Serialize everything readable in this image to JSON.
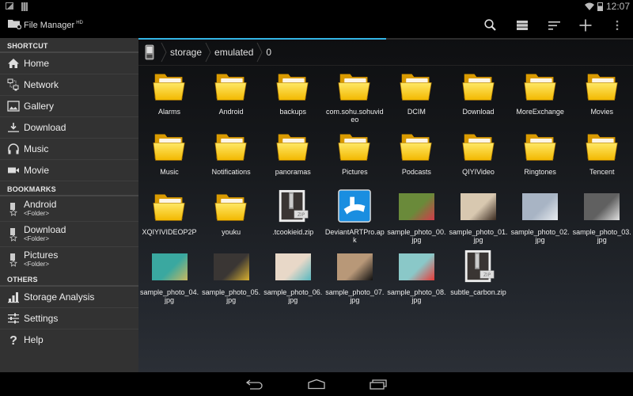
{
  "status_bar": {
    "time": "12:07",
    "icons": [
      "image-notification-icon",
      "sd-card-icon",
      "wifi-icon",
      "battery-icon"
    ]
  },
  "action_bar": {
    "app_title": "File Manager",
    "app_badge": "HD",
    "actions": [
      {
        "name": "search",
        "icon": "search-icon"
      },
      {
        "name": "view-mode",
        "icon": "list-view-icon"
      },
      {
        "name": "sort",
        "icon": "sort-icon"
      },
      {
        "name": "new",
        "icon": "plus-icon"
      },
      {
        "name": "overflow",
        "icon": "more-vert-icon"
      }
    ]
  },
  "sidebar": {
    "shortcut_header": "SHORTCUT",
    "shortcuts": [
      {
        "label": "Home",
        "icon": "home-icon"
      },
      {
        "label": "Network",
        "icon": "network-icon"
      },
      {
        "label": "Gallery",
        "icon": "gallery-icon"
      },
      {
        "label": "Download",
        "icon": "download-icon"
      },
      {
        "label": "Music",
        "icon": "headphones-icon"
      },
      {
        "label": "Movie",
        "icon": "video-camera-icon"
      }
    ],
    "bookmarks_header": "BOOKMARKS",
    "bookmarks": [
      {
        "label": "Android",
        "sub": "<Folder>"
      },
      {
        "label": "Download",
        "sub": "<Folder>"
      },
      {
        "label": "Pictures",
        "sub": "<Folder>"
      }
    ],
    "others_header": "OTHERS",
    "others": [
      {
        "label": "Storage Analysis",
        "icon": "bar-chart-icon"
      },
      {
        "label": "Settings",
        "icon": "sliders-icon"
      },
      {
        "label": "Help",
        "icon": "question-icon"
      }
    ]
  },
  "main": {
    "load_progress": 0.5,
    "accent_color": "#33b5e5",
    "breadcrumb": [
      "storage",
      "emulated",
      "0"
    ],
    "files": [
      {
        "name": "Alarms",
        "type": "folder"
      },
      {
        "name": "Android",
        "type": "folder"
      },
      {
        "name": "backups",
        "type": "folder"
      },
      {
        "name": "com.sohu.sohuvideo",
        "type": "folder"
      },
      {
        "name": "DCIM",
        "type": "folder"
      },
      {
        "name": "Download",
        "type": "folder"
      },
      {
        "name": "MoreExchange",
        "type": "folder"
      },
      {
        "name": "Movies",
        "type": "folder"
      },
      {
        "name": "Music",
        "type": "folder"
      },
      {
        "name": "Notifications",
        "type": "folder"
      },
      {
        "name": "panoramas",
        "type": "folder"
      },
      {
        "name": "Pictures",
        "type": "folder"
      },
      {
        "name": "Podcasts",
        "type": "folder"
      },
      {
        "name": "QIYIVideo",
        "type": "folder"
      },
      {
        "name": "Ringtones",
        "type": "folder"
      },
      {
        "name": "Tencent",
        "type": "folder"
      },
      {
        "name": "XQIYIVIDEOP2P",
        "type": "folder"
      },
      {
        "name": "youku",
        "type": "folder"
      },
      {
        "name": ".tcookieid.zip",
        "type": "zip"
      },
      {
        "name": "DeviantARTPro.apk",
        "type": "apk"
      },
      {
        "name": "sample_photo_00.jpg",
        "type": "photo",
        "colors": [
          "#6a8a3a",
          "#d33b4a"
        ]
      },
      {
        "name": "sample_photo_01.jpg",
        "type": "photo",
        "colors": [
          "#d8c8b0",
          "#3a2a20"
        ]
      },
      {
        "name": "sample_photo_02.jpg",
        "type": "photo",
        "colors": [
          "#a8b4c4",
          "#e8ecf0"
        ]
      },
      {
        "name": "sample_photo_03.jpg",
        "type": "photo",
        "colors": [
          "#606060",
          "#e0e0e0"
        ]
      },
      {
        "name": "sample_photo_04.jpg",
        "type": "photo",
        "colors": [
          "#3aa8a0",
          "#c8b860"
        ]
      },
      {
        "name": "sample_photo_05.jpg",
        "type": "photo",
        "colors": [
          "#3a3634",
          "#d8b030"
        ]
      },
      {
        "name": "sample_photo_06.jpg",
        "type": "photo",
        "colors": [
          "#e8d8c8",
          "#58b8c0"
        ]
      },
      {
        "name": "sample_photo_07.jpg",
        "type": "photo",
        "colors": [
          "#b89878",
          "#101010"
        ]
      },
      {
        "name": "sample_photo_08.jpg",
        "type": "photo",
        "colors": [
          "#8ac8c8",
          "#e83a38"
        ]
      },
      {
        "name": "subtle_carbon.zip",
        "type": "zip"
      }
    ]
  },
  "nav_bar": {
    "buttons": [
      "back",
      "home",
      "recents"
    ]
  }
}
